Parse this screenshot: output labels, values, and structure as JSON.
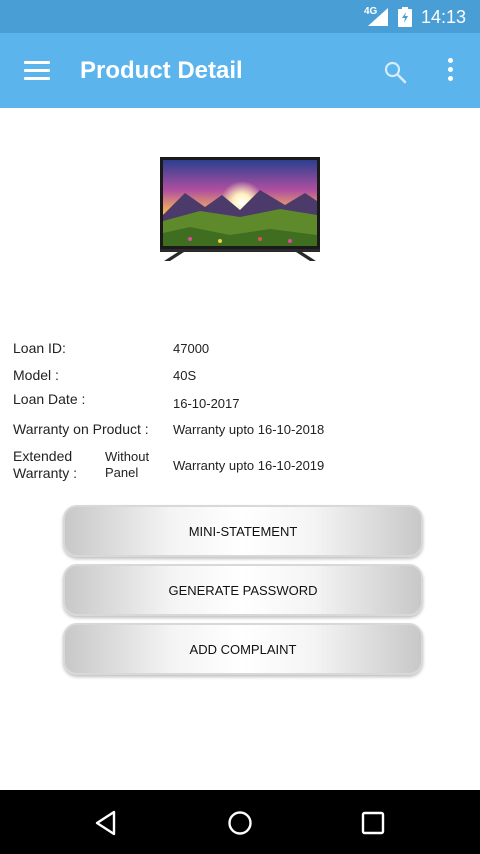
{
  "status_bar": {
    "network": "4G",
    "time": "14:13",
    "icons": [
      "signal-icon",
      "battery-icon"
    ]
  },
  "app_bar": {
    "title": "Product Detail",
    "icons": [
      "menu-icon",
      "search-icon",
      "more-vert-icon"
    ]
  },
  "product": {
    "image": "tv-icon"
  },
  "details": {
    "loan_id": {
      "label": "Loan ID:",
      "value": "47000"
    },
    "model": {
      "label": "Model :",
      "value": "40S"
    },
    "loan_date": {
      "label": "Loan Date :",
      "value": "16-10-2017"
    },
    "warranty": {
      "label": "Warranty on Product :",
      "value": "Warranty upto 16-10-2018"
    },
    "extended_warranty": {
      "label_line1": "Extended",
      "label_line2": "Warranty :",
      "type_line1": "Without",
      "type_line2": "Panel",
      "value": "Warranty upto 16-10-2019"
    }
  },
  "buttons": {
    "mini_statement": "MINI-STATEMENT",
    "generate_password": "GENERATE PASSWORD",
    "add_complaint": "ADD COMPLAINT"
  },
  "nav_bar": {
    "icons": [
      "back-icon",
      "home-icon",
      "recents-icon"
    ]
  },
  "colors": {
    "status_bar": "#4a9ed6",
    "app_bar": "#5bb4ec",
    "nav_bar": "#000000"
  }
}
